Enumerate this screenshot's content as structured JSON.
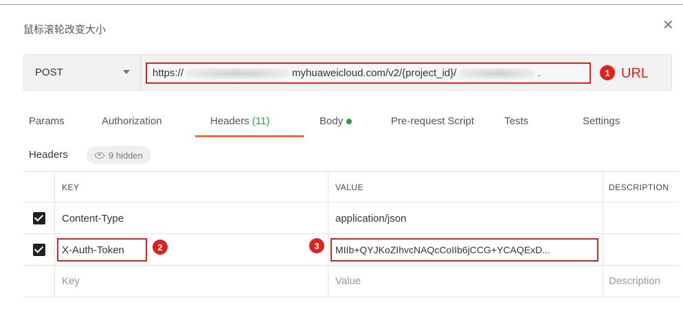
{
  "dialog": {
    "title": "鼠标滚轮改变大小",
    "close_glyph": "✕"
  },
  "request": {
    "method": "POST",
    "url_start": "https://",
    "url_middle": "myhuaweicloud.com/v2/{project_id}/",
    "url_end": "."
  },
  "tabs": {
    "params": "Params",
    "authorization": "Authorization",
    "headers": "Headers",
    "headers_count": "(11)",
    "body": "Body",
    "prerequest": "Pre-request Script",
    "tests": "Tests",
    "settings": "Settings"
  },
  "headers_section": {
    "label": "Headers",
    "hidden_text": "9 hidden"
  },
  "table": {
    "columns": {
      "key": "KEY",
      "value": "VALUE",
      "description": "DESCRIPTION"
    },
    "rows": [
      {
        "checked": true,
        "key": "Content-Type",
        "value": "application/json"
      },
      {
        "checked": true,
        "key": "X-Auth-Token",
        "value": "MIIb+QYJKoZIhvcNAQcCoIIb6jCCG+YCAQExD..."
      }
    ],
    "placeholder": {
      "key": "Key",
      "value": "Value",
      "description": "Description"
    }
  },
  "annotations": {
    "one": "1",
    "two": "2",
    "three": "3",
    "url_label": "URL"
  },
  "colors": {
    "accent": "#f26b3a",
    "annotation": "#e0201c",
    "green": "#2e9e41"
  }
}
